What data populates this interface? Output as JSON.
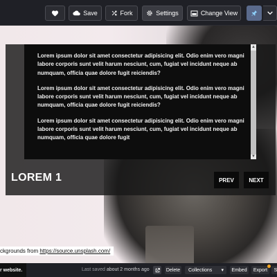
{
  "toolbar": {
    "save_label": "Save",
    "fork_label": "Fork",
    "settings_label": "Settings",
    "change_view_label": "Change View"
  },
  "slider": {
    "paragraphs": [
      "Lorem ipsum dolor sit amet consectetur adipisicing elit. Odio enim vero magni labore corporis sunt velit harum nesciunt, cum, fugiat vel incidunt neque ab numquam, officia quae dolore fugit reiciendis?",
      "Lorem ipsum dolor sit amet consectetur adipisicing elit. Odio enim vero magni labore corporis sunt velit harum nesciunt, cum, fugiat vel incidunt neque ab numquam, officia quae dolore fugit reiciendis?",
      "Lorem ipsum dolor sit amet consectetur adipisicing elit. Odio enim vero magni labore corporis sunt velit harum nesciunt, cum, fugiat vel incidunt neque ab numquam, officia quae dolore fugit"
    ],
    "title": "LOREM 1",
    "prev_label": "PREV",
    "next_label": "NEXT"
  },
  "credit": {
    "text": "ckgrounds from ",
    "link_text": "https://source.unsplash.com/"
  },
  "bottombar": {
    "ad_text": "r website.",
    "last_saved_label": "Last saved",
    "last_saved_value": "about 2 months ago",
    "delete_label": "Delete",
    "collections_label": "Collections",
    "embed_label": "Embed",
    "export_label": "Export",
    "share_label": "S"
  },
  "colors": {
    "toolbar_bg": "#1f2026",
    "panel_bg": "#0d0d0d",
    "text": "#f2f2f2"
  }
}
